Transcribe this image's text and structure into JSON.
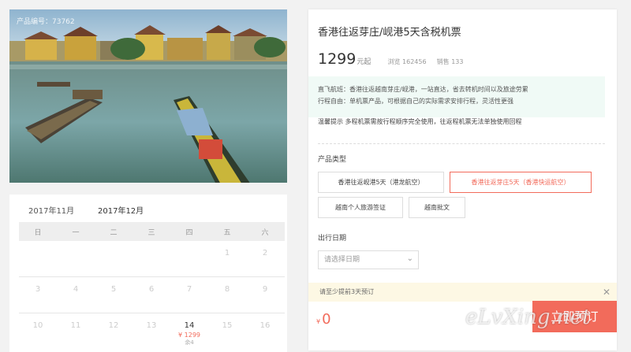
{
  "product": {
    "id_label": "产品编号：73762",
    "title": "香港往返芽庄/岘港5天含税机票",
    "price": "1299",
    "price_unit": "元起",
    "views": "浏览 162456",
    "sales": "销售 133"
  },
  "info": {
    "line1": "直飞航班：香港往返越南芽庄/岘港，一站直达，省去转机时间以及旅途劳累",
    "line2": "行程自由：单机票产品，可根据自己的实际需求安排行程，灵活性更强"
  },
  "tip": "温馨提示   多程机票需按行程顺序完全使用，往返程机票无法单独使用回程",
  "product_type": {
    "label": "产品类型",
    "options": [
      "香港往返岘港5天（港龙航空）",
      "香港往返芽庄5天（香港快运航空）",
      "越南个人旅游签证",
      "越南批文"
    ]
  },
  "date": {
    "label": "出行日期",
    "placeholder": "请选择日期"
  },
  "notice": {
    "text": "请至少提前3天预订",
    "close": "✕"
  },
  "total": {
    "currency": "¥",
    "value": "0"
  },
  "book_label": "立即预订",
  "watermark": "eLvXing.net",
  "calendar": {
    "tabs": [
      "2017年11月",
      "2017年12月"
    ],
    "weekdays": [
      "日",
      "一",
      "二",
      "三",
      "四",
      "五",
      "六"
    ],
    "row1": [
      "",
      "",
      "",
      "",
      "",
      "1",
      "2"
    ],
    "row2": [
      "3",
      "4",
      "5",
      "6",
      "7",
      "8",
      "9"
    ],
    "row3": [
      "10",
      "11",
      "12",
      "13",
      "14",
      "15",
      "16"
    ],
    "d14_price": "¥ 1299",
    "d14_left": "余4"
  },
  "colors": {
    "accent": "#f26b5b",
    "info_bg": "#f0faf6",
    "notice_bg": "#fdf8e4"
  }
}
